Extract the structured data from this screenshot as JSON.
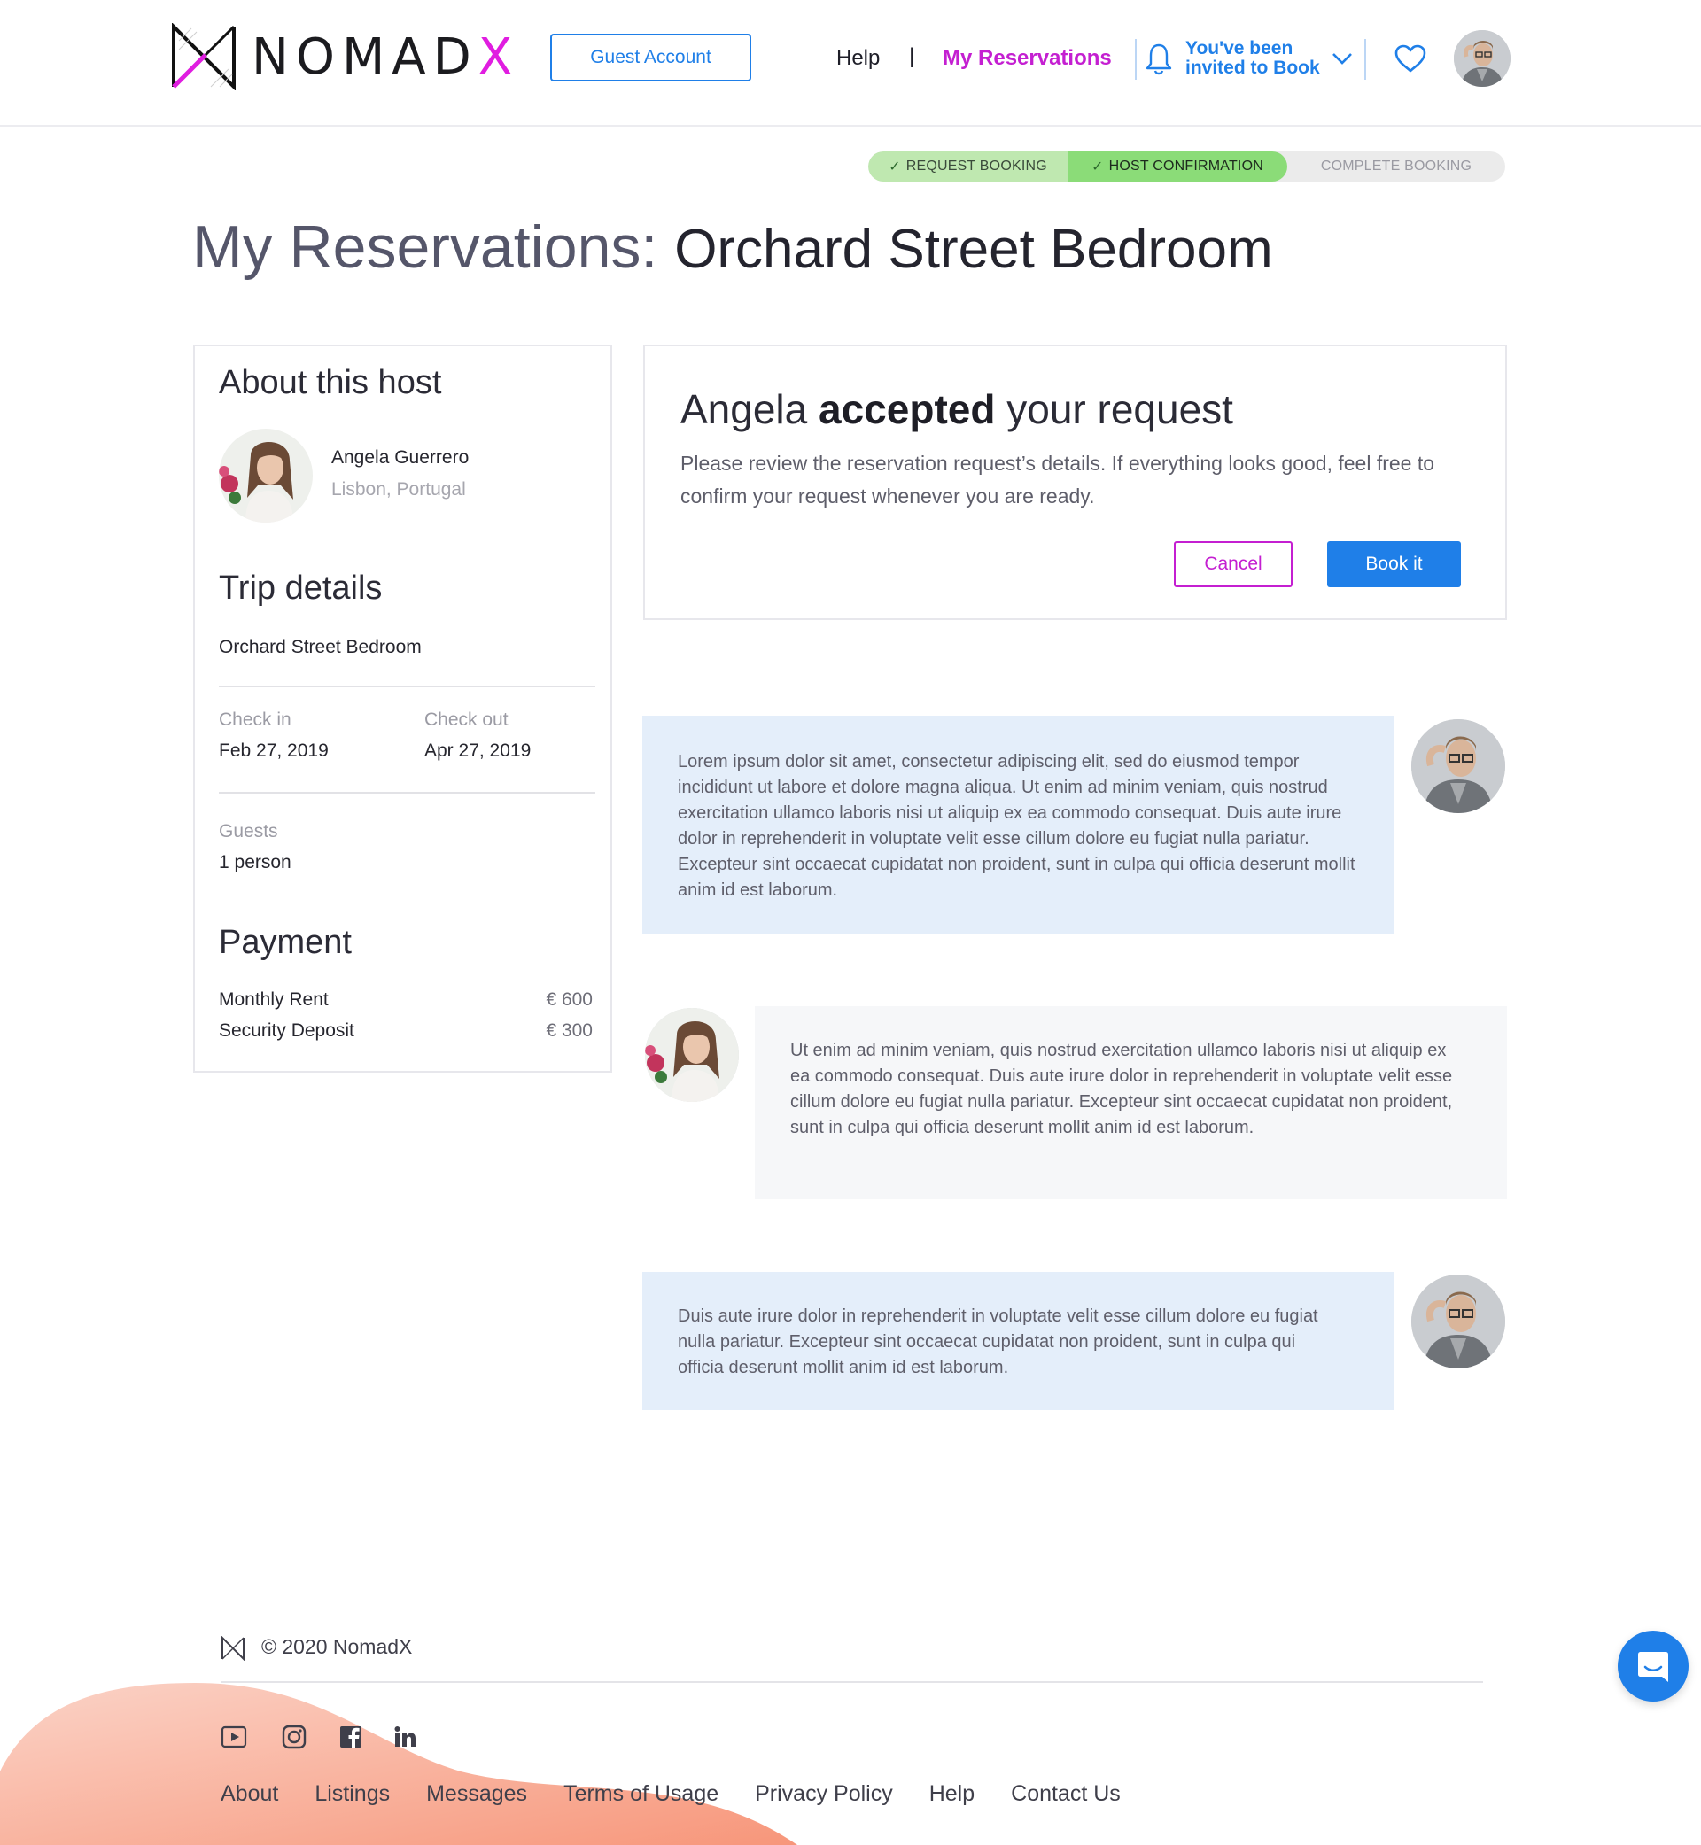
{
  "brand": {
    "name_main": "NOMAD",
    "name_accent": "X",
    "colors": {
      "accent_magenta": "#c41fd1",
      "primary_blue": "#1f7fe8",
      "progress_done": "#8bdc78",
      "guest_msg_bg": "#e4eefa",
      "host_msg_bg": "#f6f7f9"
    }
  },
  "header": {
    "account_button": "Guest Account",
    "nav_help": "Help",
    "nav_separator": "|",
    "nav_reservations": "My Reservations",
    "invite_line1": "You've been",
    "invite_line2": "invited to Book",
    "icons": [
      "bell-icon",
      "chevron-down-icon",
      "heart-icon",
      "user-avatar"
    ]
  },
  "progress": {
    "steps": [
      {
        "label": "REQUEST BOOKING",
        "done": true
      },
      {
        "label": "HOST CONFIRMATION",
        "done": true
      },
      {
        "label": "COMPLETE BOOKING",
        "done": false
      }
    ]
  },
  "page": {
    "title_prefix": "My Reservations:",
    "title_listing": "Orchard Street Bedroom"
  },
  "host_card": {
    "about_heading": "About this host",
    "host_name": "Angela Guerrero",
    "host_location": "Lisbon, Portugal",
    "trip_heading": "Trip details",
    "listing_name": "Orchard Street Bedroom",
    "checkin_label": "Check in",
    "checkin_value": "Feb 27, 2019",
    "checkout_label": "Check out",
    "checkout_value": "Apr 27, 2019",
    "guests_label": "Guests",
    "guests_value": "1 person",
    "payment_heading": "Payment",
    "payments": [
      {
        "label": "Monthly Rent",
        "amount": "€ 600"
      },
      {
        "label": "Security Deposit",
        "amount": "€ 300"
      }
    ]
  },
  "accept_card": {
    "host_first_name": "Angela",
    "status_word": "accepted",
    "status_suffix": "your request",
    "body": "Please review the reservation request’s details. If everything looks good, feel free to confirm your request whenever you are ready.",
    "cancel_label": "Cancel",
    "book_label": "Book it"
  },
  "messages": [
    {
      "from": "guest",
      "text": "Lorem ipsum dolor sit amet, consectetur adipiscing elit, sed do eiusmod tempor incididunt ut labore et dolore magna aliqua. Ut enim ad minim veniam, quis nostrud exercitation ullamco laboris nisi ut aliquip ex ea commodo consequat. Duis aute irure dolor in reprehenderit in voluptate velit esse cillum dolore eu fugiat nulla pariatur. Excepteur sint occaecat cupidatat non proident, sunt in culpa qui officia deserunt mollit anim id est laborum."
    },
    {
      "from": "host",
      "text": "Ut enim ad minim veniam, quis nostrud exercitation ullamco laboris nisi ut aliquip ex ea commodo consequat. Duis aute irure dolor in reprehenderit in voluptate velit esse cillum dolore eu fugiat nulla pariatur. Excepteur sint occaecat cupidatat non proident, sunt in culpa qui officia deserunt mollit anim id est laborum."
    },
    {
      "from": "guest",
      "text": "Duis aute irure dolor in reprehenderit in voluptate velit esse cillum dolore eu fugiat nulla pariatur. Excepteur sint occaecat cupidatat non proident, sunt in culpa qui officia deserunt mollit anim id est laborum."
    }
  ],
  "footer": {
    "copyright": "© 2020 NomadX",
    "social_icons": [
      "youtube-icon",
      "instagram-icon",
      "facebook-icon",
      "linkedin-icon"
    ],
    "links": [
      "About",
      "Listings",
      "Messages",
      "Terms of Usage",
      "Privacy Policy",
      "Help",
      "Contact Us"
    ]
  }
}
